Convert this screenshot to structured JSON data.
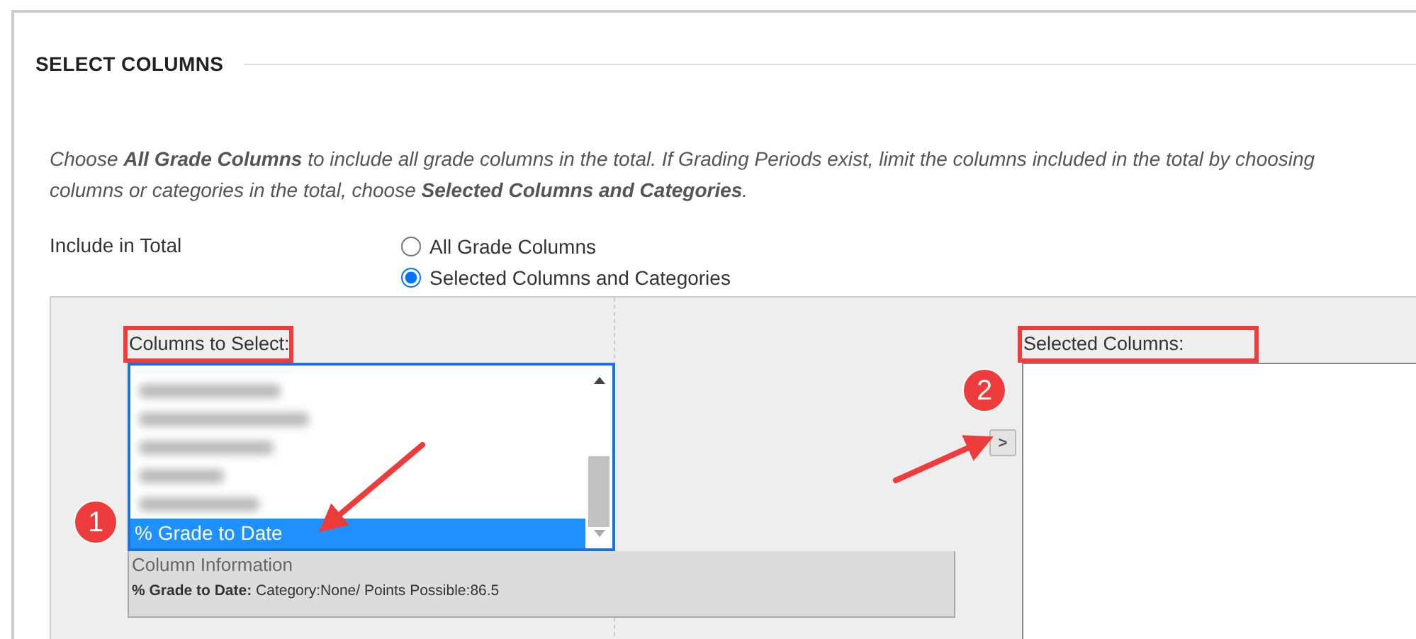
{
  "section": {
    "title": "SELECT COLUMNS"
  },
  "instructions": [
    "Choose **All Grade Columns** to include all grade columns in the total. If Grading Periods exist, limit the columns included in the total by choosing",
    "columns or categories in the total, choose **Selected Columns and Categories**."
  ],
  "include_in_total": {
    "label": "Include in Total",
    "options": [
      {
        "label": "All Grade Columns",
        "selected": false
      },
      {
        "label": "Selected Columns and Categories",
        "selected": true
      }
    ]
  },
  "columns_to_select": {
    "label": "Columns to Select:",
    "highlighted": true,
    "items": [
      {
        "kind": "blurred"
      },
      {
        "kind": "blurred"
      },
      {
        "kind": "blurred"
      },
      {
        "kind": "blurred"
      },
      {
        "kind": "blurred"
      },
      {
        "kind": "option",
        "label": "% Grade to Date",
        "selected": true
      }
    ]
  },
  "column_information": {
    "title": "Column Information",
    "details": "**% Grade to Date:** Category:None/ Points Possible:86.5"
  },
  "move_button": {
    "label": ">"
  },
  "selected_columns": {
    "label": "Selected Columns:",
    "highlighted": true
  },
  "callouts": [
    {
      "number": "1"
    },
    {
      "number": "2"
    }
  ]
}
